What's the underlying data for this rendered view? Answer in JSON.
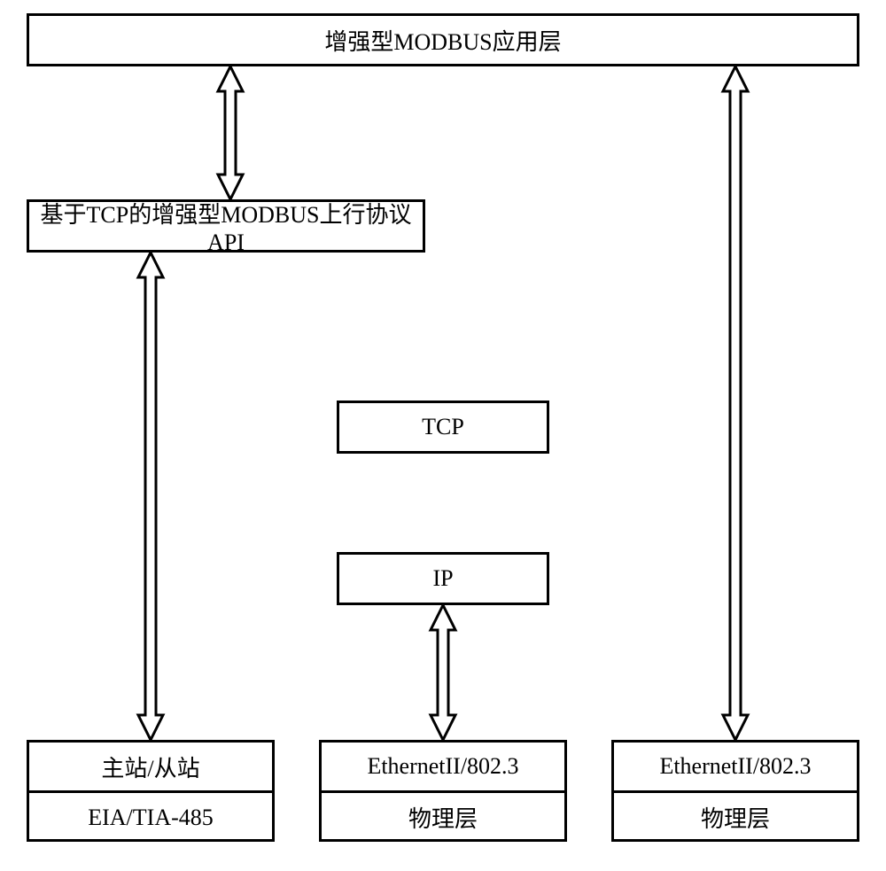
{
  "boxes": {
    "top": "增强型MODBUS应用层",
    "api": "基于TCP的增强型MODBUS上行协议API",
    "tcp": "TCP",
    "ip": "IP",
    "col1_top": "主站/从站",
    "col1_bot": "EIA/TIA-485",
    "col2_top": "EthernetII/802.3",
    "col2_bot": "物理层",
    "col3_top": "EthernetII/802.3",
    "col3_bot": "物理层"
  }
}
